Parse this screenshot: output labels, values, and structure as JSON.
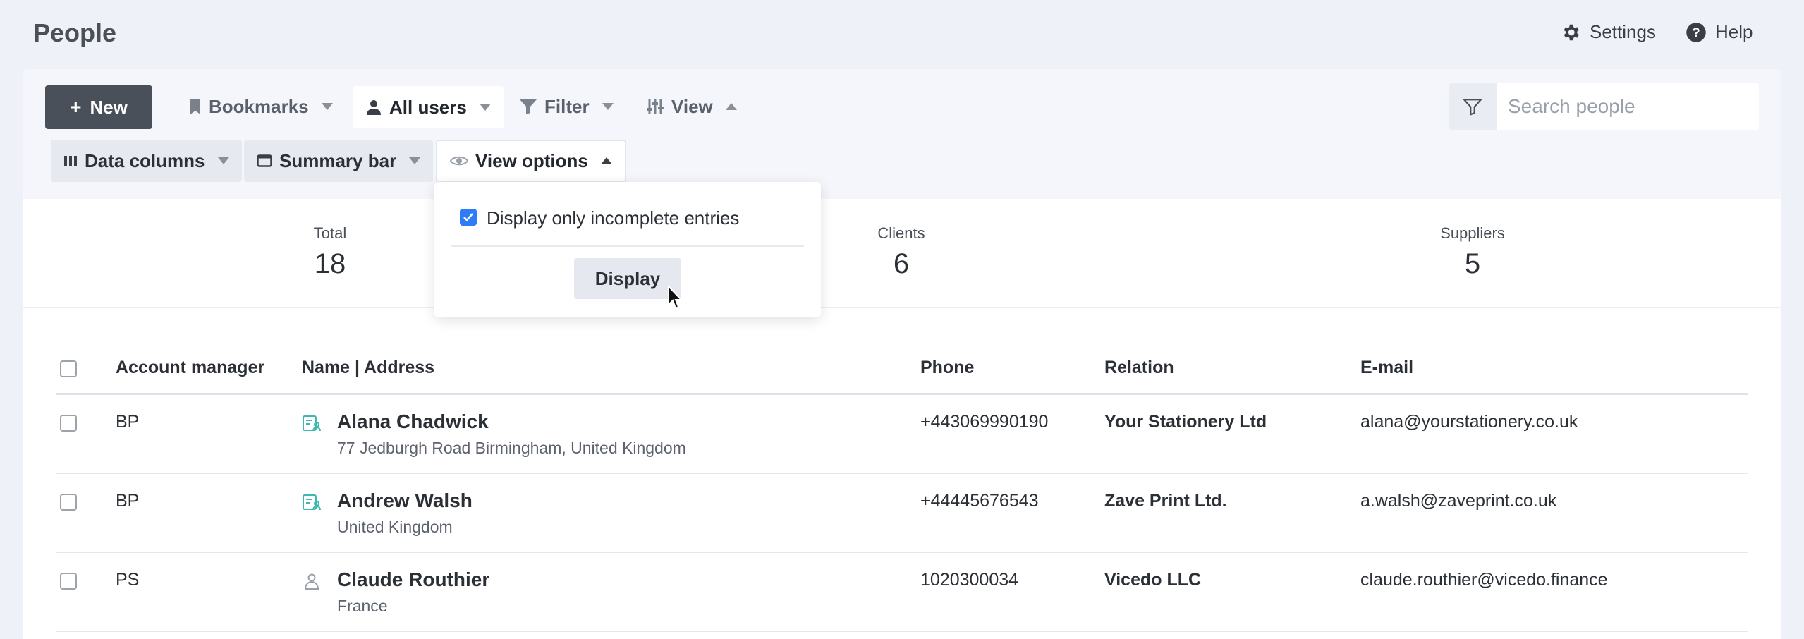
{
  "header": {
    "title": "People",
    "settings_label": "Settings",
    "help_label": "Help"
  },
  "toolbar": {
    "new_label": "New",
    "bookmarks_label": "Bookmarks",
    "all_users_label": "All users",
    "filter_label": "Filter",
    "view_label": "View",
    "data_columns_label": "Data columns",
    "summary_bar_label": "Summary bar",
    "view_options_label": "View options",
    "search_placeholder": "Search people"
  },
  "view_options_dropdown": {
    "checkbox_label": "Display only incomplete entries",
    "checkbox_checked": true,
    "button_label": "Display"
  },
  "summary": {
    "total_label": "Total",
    "total_value": "18",
    "clients_label": "Clients",
    "clients_value": "6",
    "suppliers_label": "Suppliers",
    "suppliers_value": "5"
  },
  "table": {
    "headers": {
      "account_manager": "Account manager",
      "name_address": "Name | Address",
      "phone": "Phone",
      "relation": "Relation",
      "email": "E-mail"
    },
    "rows": [
      {
        "manager": "BP",
        "name": "Alana Chadwick",
        "address": "77 Jedburgh Road Birmingham, United Kingdom",
        "phone": "+443069990190",
        "relation": "Your Stationery Ltd",
        "email": "alana@yourstationery.co.uk",
        "icon": "contact-card-icon"
      },
      {
        "manager": "BP",
        "name": "Andrew Walsh",
        "address": "United Kingdom",
        "phone": "+44445676543",
        "relation": "Zave Print Ltd.",
        "email": "a.walsh@zaveprint.co.uk",
        "icon": "contact-card-icon"
      },
      {
        "manager": "PS",
        "name": "Claude Routhier",
        "address": "France",
        "phone": "1020300034",
        "relation": "Vicedo LLC",
        "email": "claude.routhier@vicedo.finance",
        "icon": "person-icon"
      }
    ]
  },
  "colors": {
    "accent": "#2f7df6",
    "teal_icon": "#3bb8b0",
    "new_button": "#4a5059"
  }
}
